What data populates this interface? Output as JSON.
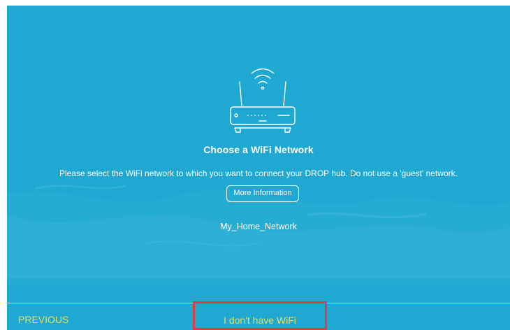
{
  "colors": {
    "background": "#1fa8d2",
    "text": "#ffffff",
    "accent_yellow": "#e8df5a",
    "highlight_border": "#e33a45"
  },
  "icons": {
    "hero": "wifi-router-icon"
  },
  "main": {
    "title": "Choose a WiFi Network",
    "subtitle": "Please select the WiFi network to which you want to connect your DROP hub. Do not use a 'guest' network.",
    "more_info_label": "More Information",
    "networks": [
      "My_Home_Network"
    ]
  },
  "footer": {
    "previous_label": "PREVIOUS",
    "no_wifi_label": "I don't have WiFi"
  }
}
